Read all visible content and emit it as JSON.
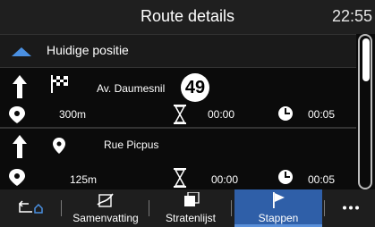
{
  "header": {
    "title": "Route details",
    "time": "22:55"
  },
  "current": {
    "label": "Huidige positie"
  },
  "steps": [
    {
      "street": "Av. Daumesnil",
      "distance": "300m",
      "duration": "00:00",
      "arrival": "00:05"
    },
    {
      "street": "Rue Picpus",
      "distance": "125m",
      "duration": "00:00",
      "arrival": "00:05"
    }
  ],
  "badge": "49",
  "toolbar": {
    "back_label": "",
    "tabs": [
      {
        "label": "Samenvatting"
      },
      {
        "label": "Stratenlijst"
      },
      {
        "label": "Stappen"
      }
    ]
  },
  "colors": {
    "accent": "#2f5fa8",
    "collapse_arrow": "#4a90e2"
  }
}
